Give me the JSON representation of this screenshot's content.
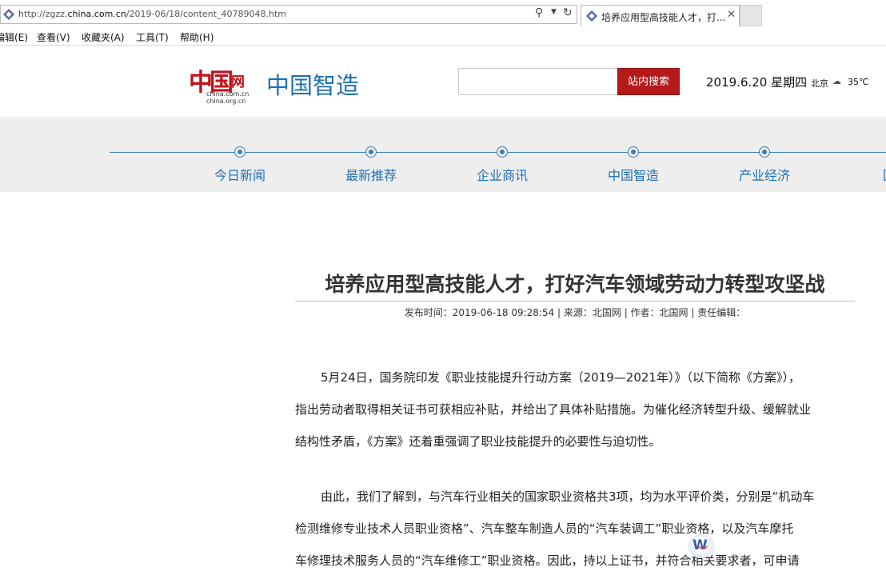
{
  "browser": {
    "url_prefix": "http://zgzz.",
    "url_domain": "china.com.cn",
    "url_path": "/2019-06/18/content_40789048.htm",
    "tab_title": "培养应用型高技能人才，打...",
    "menu": [
      "编辑(E)",
      "查看(V)",
      "收藏夹(A)",
      "工具(T)",
      "帮助(H)"
    ],
    "icons": {
      "search": "search-icon",
      "dropdown": "chevron-down-icon",
      "refresh": "refresh-icon",
      "close": "close-icon"
    }
  },
  "header": {
    "logo_main": "中国",
    "logo_wang": "网",
    "logo_sub1": "china.com.cn",
    "logo_sub2": "china.org.cn",
    "site_title": "中国智造",
    "search_placeholder": "",
    "search_button": "站内搜索",
    "date": "2019.6.20 星期四",
    "city": "北京",
    "temperature": "35℃"
  },
  "nav": {
    "items": [
      "今日新闻",
      "最新推荐",
      "企业商讯",
      "中国智造",
      "产业经济",
      "国"
    ]
  },
  "article": {
    "title": "培养应用型高技能人才，打好汽车领域劳动力转型攻坚战",
    "meta": "发布时间：2019-06-18 09:28:54 | 来源：北国网 | 作者：北国网 | 责任编辑：",
    "paragraphs": [
      {
        "lines": [
          "5月24日，国务院印发《职业技能提升行动方案（2019—2021年）》（以下简称《方案》），",
          "指出劳动者取得相关证书可获相应补贴，并给出了具体补贴措施。为催化经济转型升级、缓解就业",
          "结构性矛盾，《方案》还着重强调了职业技能提升的必要性与迫切性。"
        ]
      },
      {
        "lines": [
          "由此，我们了解到，与汽车行业相关的国家职业资格共3项，均为水平评价类，分别是“机动车",
          "检测维修专业技术人员职业资格”、汽车整车制造人员的“汽车装调工”职业资格，以及汽车摩托",
          "车修理技术服务人员的“汽车维修工”职业资格。因此，持以上证书，并符合相关要求者，可申请"
        ]
      }
    ]
  },
  "colors": {
    "brand_blue": "#1d6fb5",
    "brand_red": "#b51a1a",
    "nav_bg": "#eeeeee"
  }
}
